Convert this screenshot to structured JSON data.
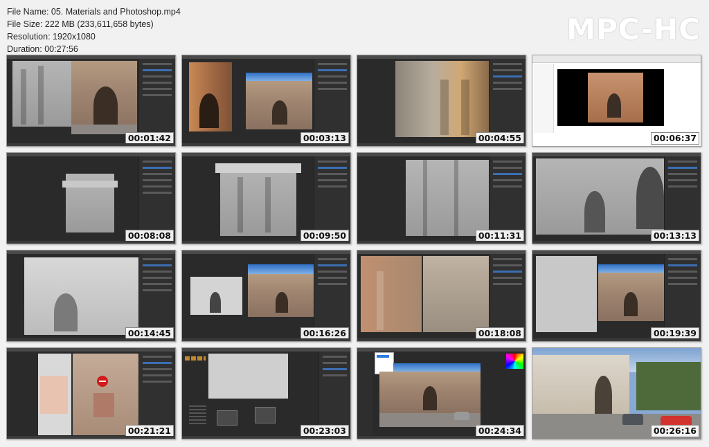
{
  "file_info": {
    "name": "File Name: 05. Materials and Photoshop.mp4",
    "size": "File Size: 222 MB (233,611,658 bytes)",
    "resolution": "Resolution: 1920x1080",
    "duration": "Duration: 00:27:56"
  },
  "logo": "MPC-HC",
  "thumbnails": [
    {
      "timestamp": "00:01:42"
    },
    {
      "timestamp": "00:03:13"
    },
    {
      "timestamp": "00:04:55"
    },
    {
      "timestamp": "00:06:37"
    },
    {
      "timestamp": "00:08:08"
    },
    {
      "timestamp": "00:09:50"
    },
    {
      "timestamp": "00:11:31"
    },
    {
      "timestamp": "00:13:13"
    },
    {
      "timestamp": "00:14:45"
    },
    {
      "timestamp": "00:16:26"
    },
    {
      "timestamp": "00:18:08"
    },
    {
      "timestamp": "00:19:39"
    },
    {
      "timestamp": "00:21:21"
    },
    {
      "timestamp": "00:23:03"
    },
    {
      "timestamp": "00:24:34"
    },
    {
      "timestamp": "00:26:16"
    }
  ]
}
